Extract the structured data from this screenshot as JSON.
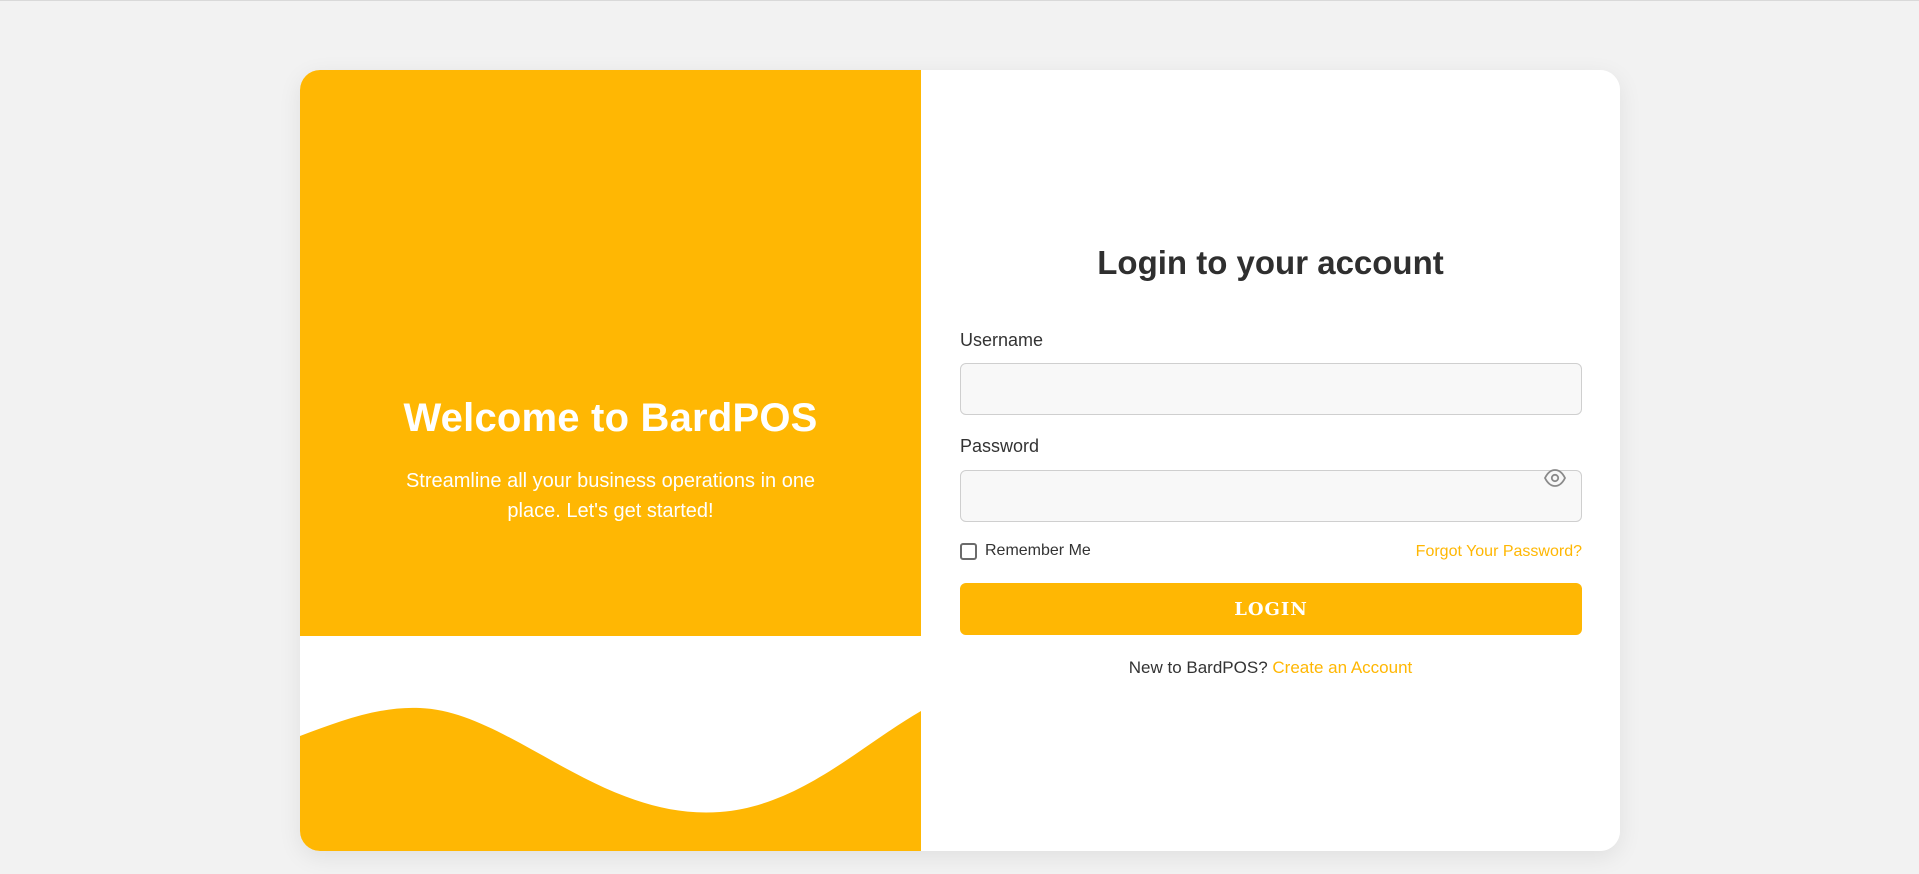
{
  "colors": {
    "accent": "#ffb703",
    "background": "#f2f2f2",
    "text_dark": "#2f2f2f"
  },
  "welcome": {
    "title": "Welcome to BardPOS",
    "subtitle": "Streamline all your business operations in one place. Let's get started!"
  },
  "login": {
    "title": "Login to your account",
    "username_label": "Username",
    "username_value": "",
    "password_label": "Password",
    "password_value": "",
    "remember_label": "Remember Me",
    "remember_checked": false,
    "forgot_link": "Forgot Your Password?",
    "submit_label": "LOGIN",
    "signup_prompt": "New to BardPOS?",
    "signup_link": "Create an Account",
    "password_toggle_icon": "eye-icon"
  }
}
